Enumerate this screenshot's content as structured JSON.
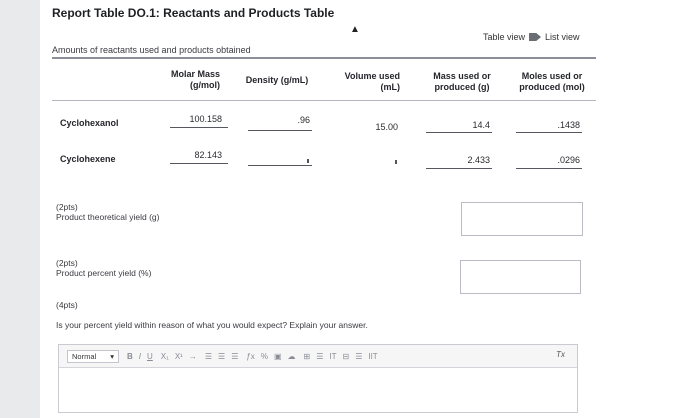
{
  "title": "Report Table DO.1: Reactants and Products Table",
  "view_toggle": {
    "table_view": "Table view",
    "list_view": "List view"
  },
  "caption": "Amounts of reactants used and products obtained",
  "table": {
    "headers": {
      "molar_mass": "Molar Mass\n(g/mol)",
      "density": "Density (g/mL)",
      "volume": "Volume used\n(mL)",
      "mass": "Mass used or\nproduced (g)",
      "moles": "Moles used or\nproduced (mol)"
    },
    "rows": [
      {
        "name": "Cyclohexanol",
        "molar_mass": "100.158",
        "density": ".96",
        "volume": "15.00",
        "mass": "14.4",
        "moles": ".1438"
      },
      {
        "name": "Cyclohexene",
        "molar_mass": "82.143",
        "density": "",
        "volume": "",
        "mass": "2.433",
        "moles": ".0296"
      }
    ]
  },
  "questions": [
    {
      "points": "(2pts)",
      "text": "Product theoretical yield (g)"
    },
    {
      "points": "(2pts)",
      "text": "Product percent yield (%)"
    },
    {
      "points": "(4pts)",
      "text": "Is your percent yield within reason of what you would expect? Explain your answer."
    }
  ],
  "editor": {
    "format_select": "Normal",
    "tools": [
      "B",
      "I",
      "U",
      "X₁",
      "X¹",
      "→",
      "☰",
      "☰",
      "☰",
      "ƒx",
      "%",
      "▣",
      "☁",
      "⊞",
      "☰",
      "IT",
      "⊟",
      "☰",
      "IIT"
    ],
    "clear_format": "Tx"
  }
}
